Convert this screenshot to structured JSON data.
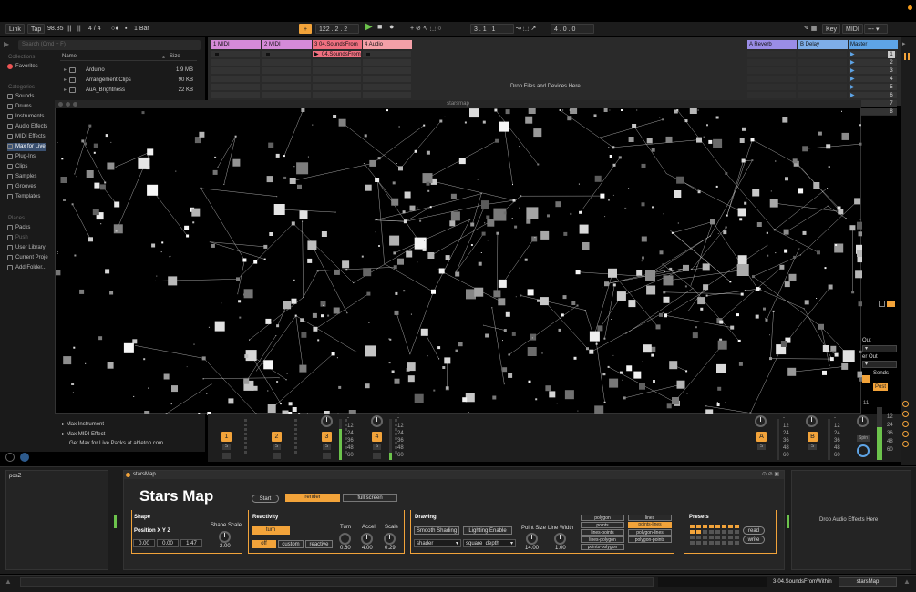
{
  "transport": {
    "link": "Link",
    "tap": "Tap",
    "bpm": "98.85",
    "signature": "4 / 4",
    "metronome": "1 Bar",
    "position": "122 .   2 .   2",
    "position2": "3 .   1 .   1",
    "position3": "4 .   0 .   0",
    "key": "Key",
    "midi": "MIDI"
  },
  "browser": {
    "search_placeholder": "Search (Cmd + F)",
    "collections_head": "Collections",
    "favorites": "Favorites",
    "categories_head": "Categories",
    "categories": [
      "Sounds",
      "Drums",
      "Instruments",
      "Audio Effects",
      "MIDI Effects",
      "Max for Live",
      "Plug-Ins",
      "Clips",
      "Samples",
      "Grooves",
      "Templates"
    ],
    "places_head": "Places",
    "places": [
      "Packs",
      "Push",
      "User Library",
      "Current Proje",
      "Add Folder..."
    ],
    "col_name": "Name",
    "col_size": "Size",
    "files": [
      {
        "name": "Arduino",
        "size": "1.9 MB"
      },
      {
        "name": "Arrangement Clips",
        "size": "90 KB"
      },
      {
        "name": "AuA_Brightness",
        "size": "22 KB"
      }
    ],
    "bottom_items": [
      "Max Instrument",
      "Max MIDI Effect"
    ],
    "bottom_link": "Get Max for Live Packs at ableton.com"
  },
  "session": {
    "tracks": [
      {
        "name": "1 MIDI",
        "color": "#d58ad8"
      },
      {
        "name": "2 MIDI",
        "color": "#d58ad8"
      },
      {
        "name": "3 04.SoundsFrom",
        "color": "#f07080"
      },
      {
        "name": "4 Audio",
        "color": "#f4a0a8"
      }
    ],
    "returns": [
      {
        "name": "A Reverb",
        "color": "#9a8de6"
      },
      {
        "name": "B Delay",
        "color": "#7eaee8"
      }
    ],
    "master": {
      "name": "Master",
      "color": "#5ea4e6"
    },
    "playing_clip": "04.SoundsFrom",
    "scene_numbers": [
      "1",
      "2",
      "3",
      "4",
      "5",
      "6",
      "7",
      "8"
    ],
    "drop_files": "Drop Files and Devices Here"
  },
  "visualizer": {
    "window_title": "starsmap"
  },
  "mixer": {
    "track_numbers": [
      "1",
      "2",
      "3",
      "4"
    ],
    "return_letters": [
      "A",
      "B"
    ],
    "s_label": "S",
    "scale": [
      "12",
      "24",
      "36",
      "48",
      "60"
    ],
    "scale_top": "-",
    "master_extra": "11",
    "spin": "Spin",
    "io_out": "Out",
    "io_post": "Post",
    "io_sends": "Sends"
  },
  "device": {
    "left_panel_title": "posZ",
    "name": "starsMap",
    "title": "Stars Map",
    "start": "Start",
    "render": "render",
    "full_screen": "full screen",
    "shape": {
      "head": "Shape",
      "position_label": "Position X Y Z",
      "x": "0.00",
      "y": "0.00",
      "z": "1.47",
      "scale_label": "Shape Scale",
      "scale_value": "2.00"
    },
    "reactivity": {
      "head": "Reactivity",
      "turn_btn": "turn",
      "off": "off",
      "custom": "custom",
      "reactive": "reactive",
      "knobs": [
        {
          "label": "Turn",
          "value": "0.60"
        },
        {
          "label": "Accel",
          "value": "4.00"
        },
        {
          "label": "Scale",
          "value": "0.29"
        }
      ]
    },
    "drawing": {
      "head": "Drawing",
      "smooth": "Smooth Shading",
      "lighting": "Lighting Enable",
      "shader": "shader",
      "depth": "square_depth",
      "point_size_label": "Point Size",
      "point_size": "14.00",
      "line_width_label": "Line Width",
      "line_width": "1.00"
    },
    "modes": [
      {
        "left": "polygon",
        "right": "lines",
        "active": false
      },
      {
        "left": "points",
        "right": "points-lines",
        "active": true
      },
      {
        "left": "lines-points",
        "right": "polygon-lines",
        "active": false
      },
      {
        "left": "lines-polygon",
        "right": "polygon-points",
        "active": false
      },
      {
        "left": "points-polygon",
        "right": "",
        "active": false
      }
    ],
    "presets": {
      "head": "Presets",
      "read": "read",
      "write": "write"
    },
    "drop_fx": "Drop Audio Effects Here"
  },
  "status": {
    "clip_name": "3-04.SoundsFromWithin",
    "device_name": "starsMap"
  },
  "colors": {
    "accent": "#f2a33a",
    "bg": "#1c1c1c"
  }
}
